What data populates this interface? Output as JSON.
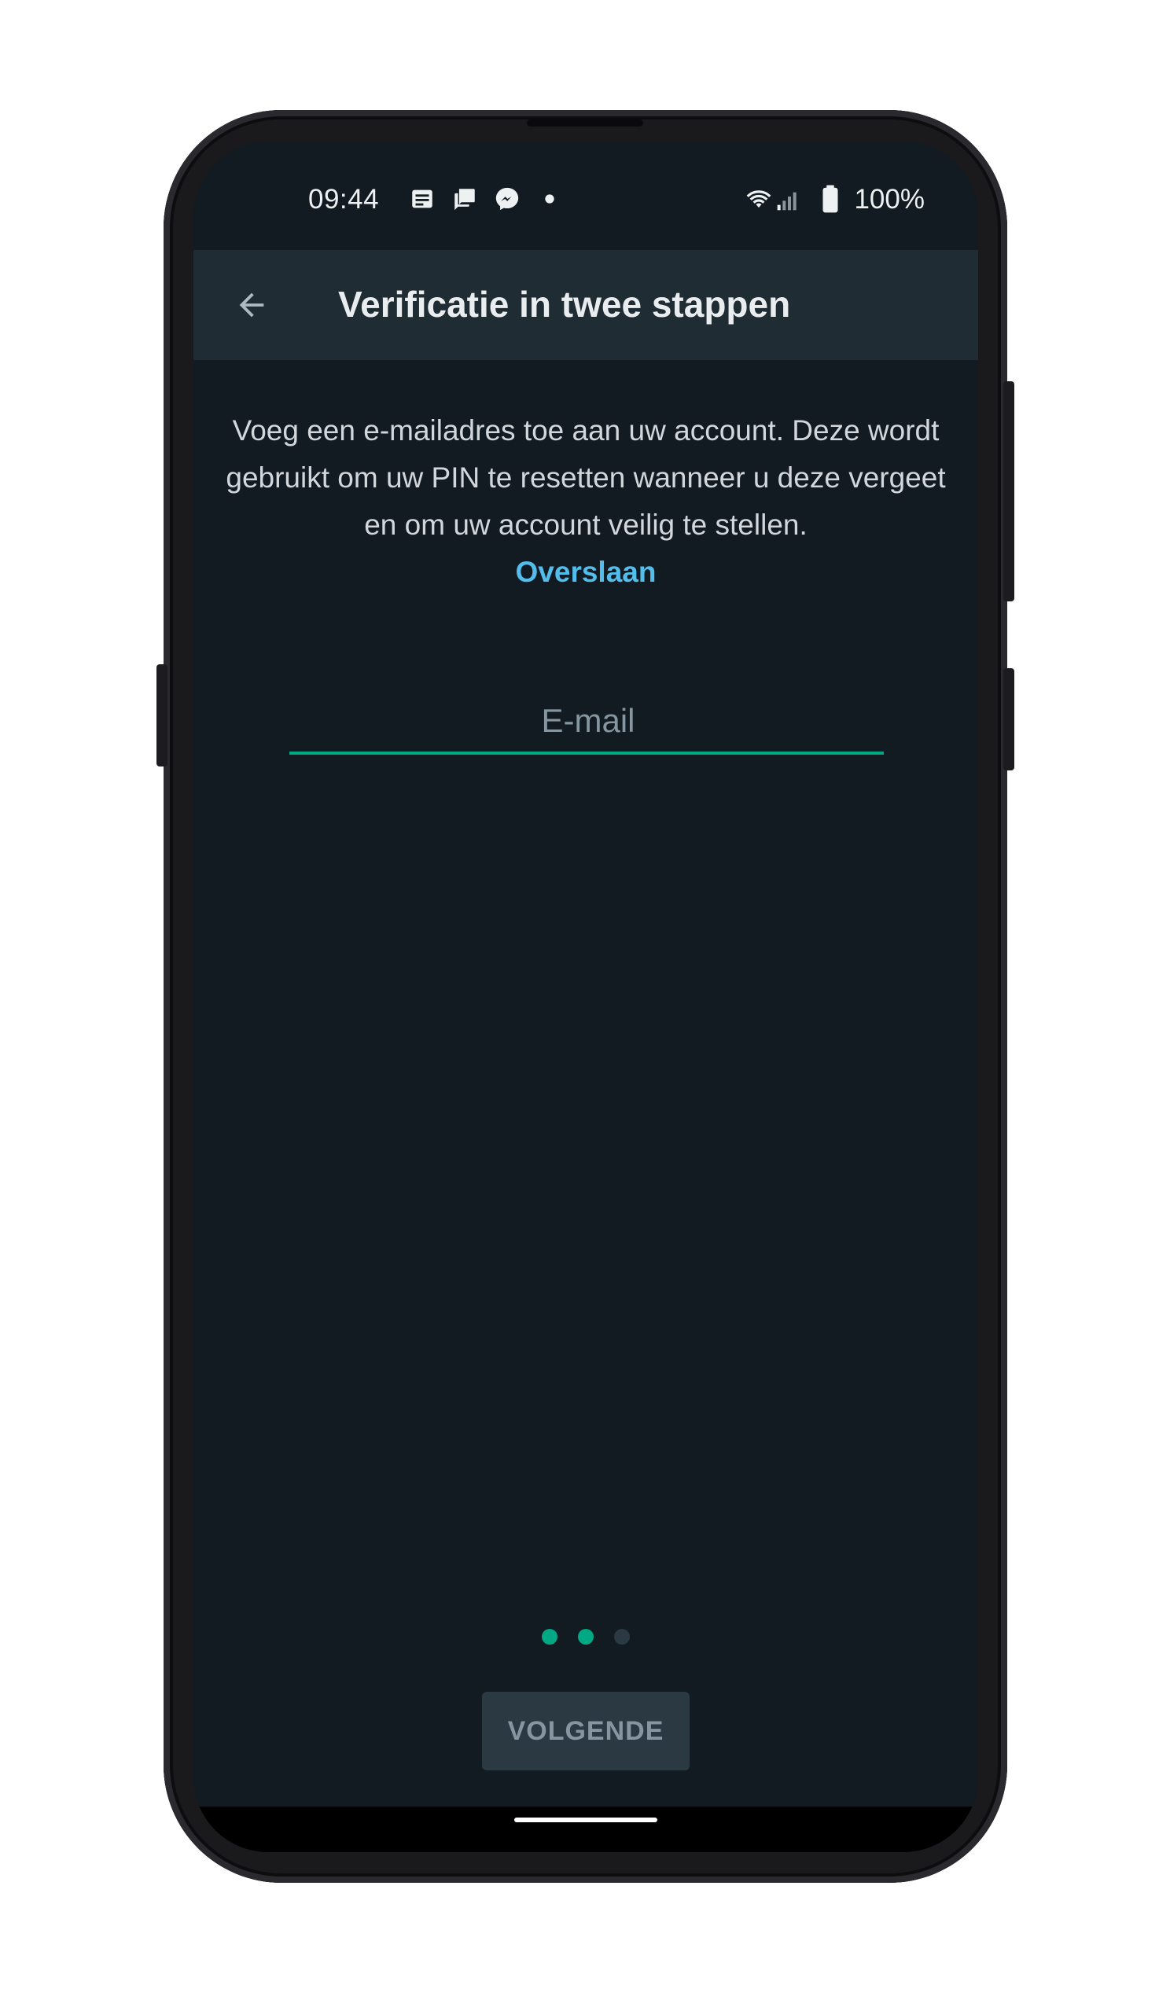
{
  "status_bar": {
    "time": "09:44",
    "notification_icons": [
      "news-icon",
      "chat-icon",
      "messenger-icon",
      "more-notifications-dot-icon"
    ],
    "system_icons": [
      "wifi-icon",
      "signal-icon",
      "battery-icon"
    ],
    "battery": "100%"
  },
  "app_bar": {
    "back_icon": "arrow-left-icon",
    "title": "Verificatie in twee stappen"
  },
  "content": {
    "description": "Voeg een e-mailadres toe aan uw account. Deze wordt gebruikt om uw PIN te resetten wanneer u deze vergeet en om uw account veilig te stellen.",
    "skip_link": "Overslaan",
    "email": {
      "placeholder": "E-mail",
      "value": ""
    }
  },
  "pager": {
    "total_steps": 3,
    "active_steps": 2
  },
  "footer": {
    "next_button": "VOLGENDE",
    "next_enabled": false
  },
  "colors": {
    "background": "#111b21",
    "app_bar": "#202c33",
    "accent": "#00a884",
    "link": "#53bdeb",
    "dot_inactive": "#2a3942",
    "button_disabled_bg": "#2a3942",
    "button_disabled_text": "#8696a0"
  }
}
